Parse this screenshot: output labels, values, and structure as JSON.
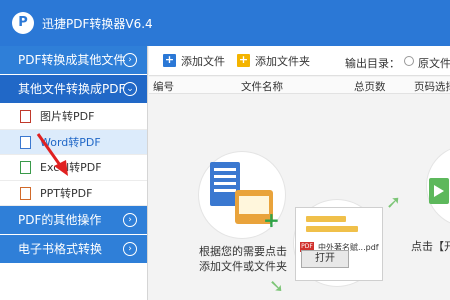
{
  "app": {
    "title": "迅捷PDF转换器V6.4",
    "logo_letter": "P"
  },
  "sidebar": {
    "categories": [
      {
        "label": "PDF转换成其他文件"
      },
      {
        "label": "其他文件转换成PDF"
      },
      {
        "label": "PDF的其他操作"
      },
      {
        "label": "电子书格式转换"
      }
    ],
    "chevron": "›",
    "subitems": [
      {
        "label": "图片转PDF",
        "icon": "image-file-icon"
      },
      {
        "label": "Word转PDF",
        "icon": "word-file-icon"
      },
      {
        "label": "Excel转PDF",
        "icon": "excel-file-icon"
      },
      {
        "label": "PPT转PDF",
        "icon": "ppt-file-icon"
      }
    ],
    "selected_index": 1
  },
  "toolbar": {
    "add_file": "添加文件",
    "add_folder": "添加文件夹",
    "output_label": "输出目录：",
    "radio_label": "原文件"
  },
  "table": {
    "headers": [
      "编号",
      "文件名称",
      "总页数",
      "页码选择"
    ]
  },
  "instructions": {
    "caption_line1": "根据您的需要点击",
    "caption_line2": "添加文件或文件夹",
    "caption_right": "点击【开",
    "open_button": "打开",
    "file_name": "中外著名赋...pdf",
    "pdf_badge": "PDF"
  },
  "colors": {
    "title_bar": "#2b78d6",
    "category_bg": "#2f7fd8",
    "selected_bg": "#dcebfb",
    "accent_green": "#5db85c"
  }
}
